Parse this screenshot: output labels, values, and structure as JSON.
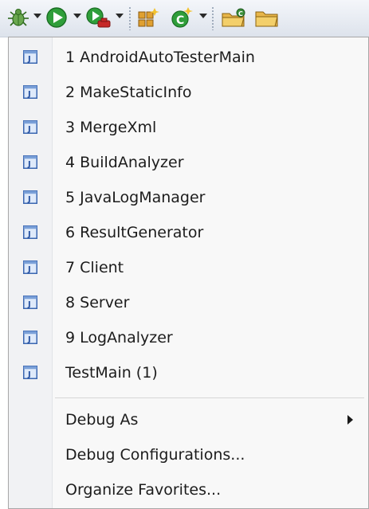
{
  "toolbar": {
    "icons": [
      "debug-bug-icon",
      "run-icon",
      "run-external-tool-icon",
      "new-package-icon",
      "new-class-icon",
      "open-type-icon",
      "open-folder-icon"
    ]
  },
  "menu": {
    "items": [
      {
        "label": "1 AndroidAutoTesterMain"
      },
      {
        "label": "2 MakeStaticInfo"
      },
      {
        "label": "3 MergeXml"
      },
      {
        "label": "4 BuildAnalyzer"
      },
      {
        "label": "5 JavaLogManager"
      },
      {
        "label": "6 ResultGenerator"
      },
      {
        "label": "7 Client"
      },
      {
        "label": "8 Server"
      },
      {
        "label": "9 LogAnalyzer"
      },
      {
        "label": "TestMain (1)"
      }
    ],
    "actions": [
      {
        "label": "Debug As"
      },
      {
        "label": "Debug Configurations..."
      },
      {
        "label": "Organize Favorites..."
      }
    ],
    "java_icon_letter": "J",
    "colors": {
      "java_icon_border": "#3a66b0",
      "java_icon_fill": "#dfeafa",
      "java_icon_letter": "#2a54a3"
    }
  }
}
